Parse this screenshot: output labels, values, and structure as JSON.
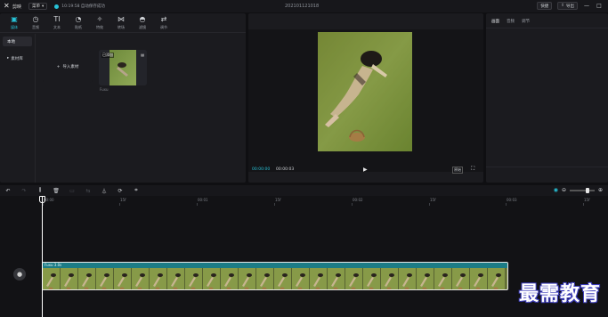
{
  "titlebar": {
    "app_name": "剪映",
    "menu_label": "菜单",
    "save_status": "10:19:58 自动保存成功",
    "project_title": "202101121018",
    "shortcut_label": "快捷",
    "export_label": "导出",
    "window_controls": [
      "—",
      "□"
    ]
  },
  "media": {
    "tabs": [
      {
        "icon": "media-icon",
        "glyph": "▣",
        "label": "媒体"
      },
      {
        "icon": "audio-icon",
        "glyph": "◷",
        "label": "音频"
      },
      {
        "icon": "text-icon",
        "glyph": "TI",
        "label": "文本"
      },
      {
        "icon": "sticker-icon",
        "glyph": "◔",
        "label": "贴纸"
      },
      {
        "icon": "effects-icon",
        "glyph": "✧",
        "label": "特效"
      },
      {
        "icon": "transition-icon",
        "glyph": "⋈",
        "label": "转场"
      },
      {
        "icon": "filter-icon",
        "glyph": "◓",
        "label": "滤镜"
      },
      {
        "icon": "adjust-icon",
        "glyph": "⇄",
        "label": "调节"
      }
    ],
    "side_items": [
      "本地",
      "素材库"
    ],
    "import_label": "导入素材",
    "clip_badge": "已添加",
    "clip_name": "Fuxu"
  },
  "player": {
    "title": "",
    "current_time": "00:00:00",
    "total_time": "00:00:03",
    "ratio_label": "原始"
  },
  "props": {
    "tabs": [
      "画面",
      "音频",
      "调节"
    ]
  },
  "timeline": {
    "ruler": [
      "00:00",
      "15f",
      "00:01",
      "15f",
      "00:02",
      "15f",
      "00:03",
      "15f"
    ],
    "clip_label": "Fuxu  3.0s"
  },
  "watermark": "最需教育",
  "colors": {
    "accent": "#27c3d8",
    "clip_header": "#1c7c86",
    "panel": "#1b1b1f",
    "background": "#0f0f12"
  }
}
